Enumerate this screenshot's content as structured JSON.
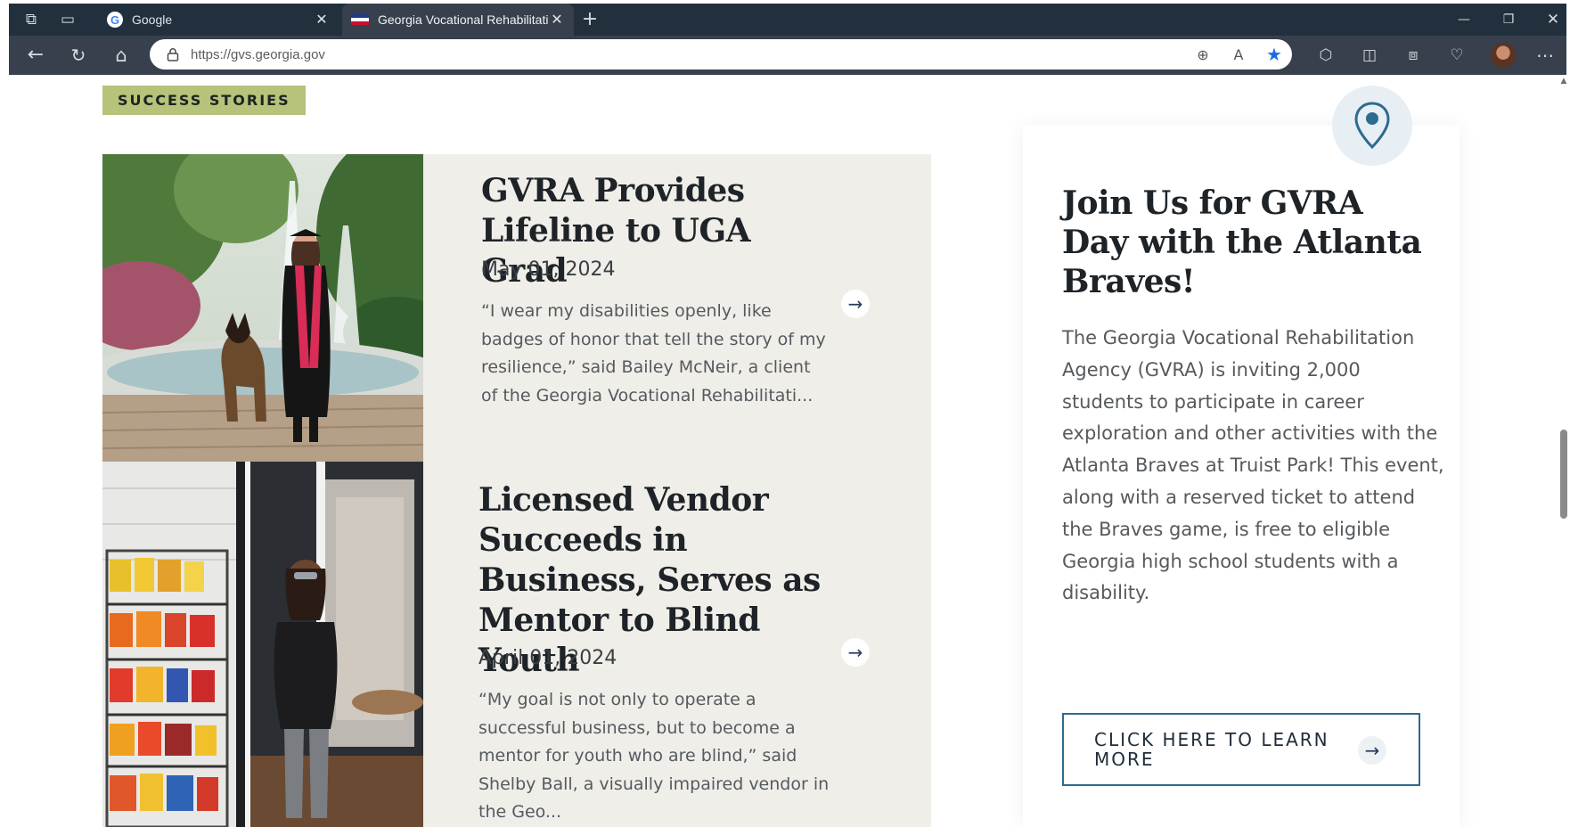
{
  "browser": {
    "tabs": [
      {
        "title": "Google",
        "favicon": "google-g-icon"
      },
      {
        "title": "Georgia Vocational Rehabilitation Agency",
        "favicon": "georgia-flag-icon",
        "active": true
      }
    ],
    "url": "https://gvs.georgia.gov",
    "icons": {
      "workspaces": "⧉",
      "tab_actions": "▭",
      "new_tab": "+",
      "minimize": "—",
      "restore": "❐",
      "close": "✕",
      "back": "←",
      "refresh": "↻",
      "home": "⌂",
      "lock": "🔒",
      "zoom": "⊕",
      "read_aloud": "A",
      "favorite": "★",
      "extensions": "⬡",
      "split": "◫",
      "collections": "⧈",
      "performance": "♡",
      "more": "⋯",
      "tab_close": "✕"
    }
  },
  "section": {
    "badge": "SUCCESS STORIES"
  },
  "stories": [
    {
      "title": "GVRA Provides Lifeline to UGA Grad",
      "date": "May 01, 2024",
      "excerpt": "“I wear my disabilities openly, like badges of honor that tell the story of my resilience,” said Bailey McNeir, a client of the Georgia Vocational Rehabilitati...",
      "arrow": "→"
    },
    {
      "title": "Licensed Vendor Succeeds in Business, Serves as Mentor to Blind Youth",
      "date": "April 01, 2024",
      "excerpt": "“My goal is not only to operate a successful business, but to become a mentor for youth who are blind,” said Shelby Ball, a visually impaired vendor in the Geo...",
      "arrow": "→"
    }
  ],
  "event": {
    "title": "Join Us for GVRA Day with the Atlanta Braves!",
    "body": "The Georgia Vocational Rehabilitation Agency (GVRA) is inviting 2,000 students to participate in career exploration and other activities with the Atlanta Braves at Truist Park! This event, along with a reserved ticket to attend the Braves game, is free to eligible Georgia high school students with a disability.",
    "cta": "CLICK HERE TO LEARN MORE",
    "cta_arrow": "→"
  },
  "colors": {
    "chrome_dark": "#222f3d",
    "chrome_toolbar": "#37404c",
    "badge": "#b7c27a",
    "panel": "#f0eee9",
    "heading": "#1e2328",
    "cta_border": "#2d6b8f",
    "star": "#1a6fe0"
  }
}
